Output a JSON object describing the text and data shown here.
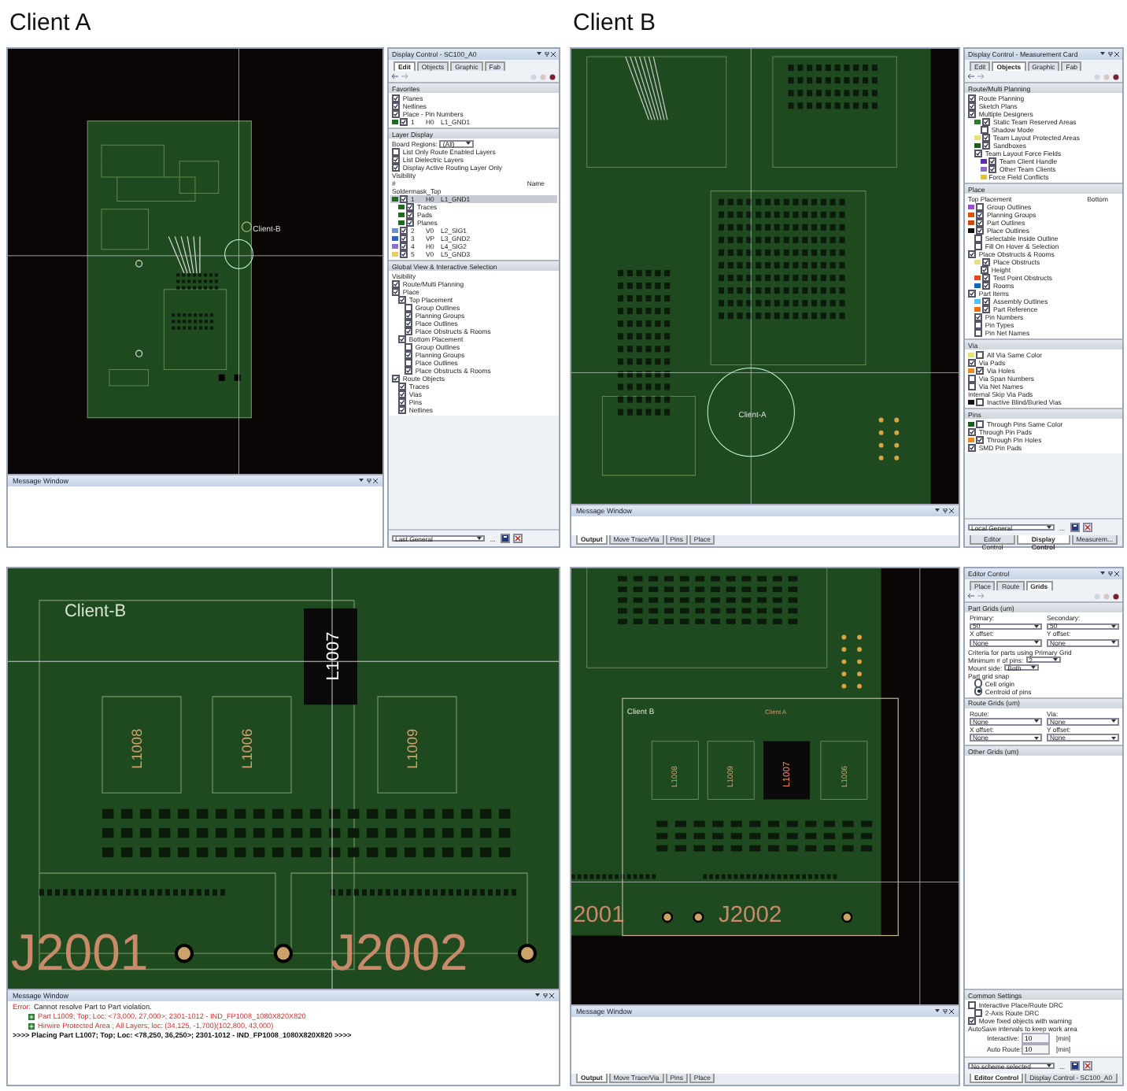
{
  "column_labels": [
    "Client A",
    "Client B"
  ],
  "quadrants": [
    {
      "canvas": {
        "kind": "overview-a",
        "labels": [
          "Client-B"
        ]
      },
      "message_window": {
        "title": "Message Window"
      },
      "panel": {
        "title": "Display Control - SC100_A0",
        "tabs": [
          {
            "label": "Edit",
            "selected": true
          },
          {
            "label": "Objects",
            "selected": false
          },
          {
            "label": "Graphic",
            "selected": false
          },
          {
            "label": "Fab",
            "selected": false
          }
        ],
        "sections": [
          {
            "title": "Favorites",
            "rows": [
              {
                "kind": "check",
                "label": "Planes",
                "checked": true
              },
              {
                "kind": "check",
                "label": "Netlines",
                "checked": true
              },
              {
                "kind": "check",
                "label": "Place - Pin Numbers",
                "checked": true
              },
              {
                "kind": "layer",
                "cells": [
                  "1",
                  "H0",
                  "L1_GND1"
                ],
                "checked": true,
                "color": "#1f6b1f",
                "selected": false
              }
            ]
          },
          {
            "title": "Layer Display",
            "rows": [
              {
                "kind": "field",
                "label": "Board Regions:",
                "value": "(All)"
              },
              {
                "kind": "check",
                "label": "List Only Route Enabled Layers",
                "checked": false
              },
              {
                "kind": "check",
                "label": "List Dielectric Layers",
                "checked": true
              },
              {
                "kind": "check",
                "label": "Display Active Routing Layer Only",
                "checked": true
              },
              {
                "kind": "text",
                "label": "Visibility"
              },
              {
                "kind": "header",
                "cells": [
                  "#",
                  "Name"
                ]
              },
              {
                "kind": "text",
                "label": "Soldermask_Top"
              },
              {
                "kind": "layer",
                "cells": [
                  "1",
                  "H0",
                  "L1_GND1"
                ],
                "checked": true,
                "color": "#1f6b1f",
                "selected": true,
                "children": [
                  {
                    "kind": "check",
                    "label": "Traces",
                    "checked": true,
                    "color": "#1f6b1f"
                  },
                  {
                    "kind": "check",
                    "label": "Pads",
                    "checked": true,
                    "color": "#1f6b1f"
                  },
                  {
                    "kind": "check",
                    "label": "Planes",
                    "checked": true,
                    "color": "#1f6b1f"
                  }
                ]
              },
              {
                "kind": "layer",
                "cells": [
                  "2",
                  "V0",
                  "L2_SIG1"
                ],
                "checked": true,
                "color": "#6d8fd6",
                "selected": false
              },
              {
                "kind": "layer",
                "cells": [
                  "3",
                  "VP",
                  "L3_GND2"
                ],
                "checked": true,
                "color": "#2f5fcf",
                "selected": false
              },
              {
                "kind": "layer",
                "cells": [
                  "4",
                  "H0",
                  "L4_SIG2"
                ],
                "checked": true,
                "color": "#8a6fd0",
                "selected": false
              },
              {
                "kind": "layer",
                "cells": [
                  "5",
                  "V0",
                  "L5_GND3"
                ],
                "checked": true,
                "color": "#e0d060",
                "selected": false
              }
            ]
          },
          {
            "title": "Global View & Interactive Selection",
            "rows": [
              {
                "kind": "text",
                "label": "Visibility"
              },
              {
                "kind": "check",
                "label": "Route/Multi Planning",
                "checked": true
              },
              {
                "kind": "check",
                "label": "Place",
                "checked": true,
                "children": [
                  {
                    "kind": "check",
                    "label": "Top Placement",
                    "checked": true,
                    "children": [
                      {
                        "kind": "check",
                        "label": "Group Outlines",
                        "checked": false
                      },
                      {
                        "kind": "check",
                        "label": "Planning Groups",
                        "checked": true
                      },
                      {
                        "kind": "check",
                        "label": "Place Outlines",
                        "checked": true
                      },
                      {
                        "kind": "check",
                        "label": "Place Obstructs & Rooms",
                        "checked": true
                      }
                    ]
                  },
                  {
                    "kind": "check",
                    "label": "Bottom Placement",
                    "checked": true,
                    "children": [
                      {
                        "kind": "check",
                        "label": "Group Outlines",
                        "checked": false
                      },
                      {
                        "kind": "check",
                        "label": "Planning Groups",
                        "checked": true
                      },
                      {
                        "kind": "check",
                        "label": "Place Outlines",
                        "checked": false
                      },
                      {
                        "kind": "check",
                        "label": "Place Obstructs & Rooms",
                        "checked": true
                      }
                    ]
                  }
                ]
              },
              {
                "kind": "check",
                "label": "Route Objects",
                "checked": true,
                "children": [
                  {
                    "kind": "check",
                    "label": "Traces",
                    "checked": true
                  },
                  {
                    "kind": "check",
                    "label": "Vias",
                    "checked": true
                  },
                  {
                    "kind": "check",
                    "label": "Pins",
                    "checked": true
                  },
                  {
                    "kind": "check",
                    "label": "Netlines",
                    "checked": true
                  }
                ]
              }
            ]
          }
        ],
        "footer": {
          "select": "Last General",
          "more": "..."
        }
      }
    },
    {
      "canvas": {
        "kind": "overview-b",
        "labels": [
          "Client-A"
        ]
      },
      "message_window": {
        "title": "Message Window",
        "tabs": [
          {
            "label": "Output",
            "selected": true
          },
          {
            "label": "Move Trace/Via",
            "selected": false
          },
          {
            "label": "Pins",
            "selected": false
          },
          {
            "label": "Place",
            "selected": false
          }
        ]
      },
      "panel": {
        "title": "Display Control - Measurement Card",
        "tabs": [
          {
            "label": "Edit",
            "selected": false
          },
          {
            "label": "Objects",
            "selected": true
          },
          {
            "label": "Graphic",
            "selected": false
          },
          {
            "label": "Fab",
            "selected": false
          }
        ],
        "sections": [
          {
            "title": "Route/Multi Planning",
            "rows": [
              {
                "kind": "check",
                "label": "Route Planning",
                "checked": true
              },
              {
                "kind": "check",
                "label": "Sketch Plans",
                "checked": true
              },
              {
                "kind": "check",
                "label": "Multiple Designers",
                "checked": true,
                "children": [
                  {
                    "kind": "check",
                    "label": "Static Team Reserved Areas",
                    "checked": true,
                    "color": "#2e7d32",
                    "children": [
                      {
                        "kind": "check",
                        "label": "Shadow Mode",
                        "checked": false
                      }
                    ]
                  },
                  {
                    "kind": "check",
                    "label": "Team Layout Protected Areas",
                    "checked": true,
                    "color": "#e8e07a"
                  },
                  {
                    "kind": "check",
                    "label": "Sandboxes",
                    "checked": true,
                    "color": "#1b5e20"
                  },
                  {
                    "kind": "check",
                    "label": "Team Layout Force Fields",
                    "checked": true,
                    "children": [
                      {
                        "kind": "check",
                        "label": "Team Client Handle",
                        "checked": true,
                        "color": "#5e2aa8"
                      },
                      {
                        "kind": "check",
                        "label": "Other Team Clients",
                        "checked": true,
                        "color": "#8d6ac8"
                      },
                      {
                        "kind": "text",
                        "label": "Force Field Conflicts",
                        "color": "#e0c040"
                      }
                    ]
                  }
                ]
              }
            ]
          },
          {
            "title": "Place",
            "rows": [
              {
                "kind": "header",
                "cells": [
                  "Top Placement",
                  "Bottom"
                ]
              },
              {
                "kind": "check",
                "label": "Group Outlines",
                "checked": false,
                "color": "#9c4dcc"
              },
              {
                "kind": "check",
                "label": "Planning Groups",
                "checked": true,
                "color": "#e65100"
              },
              {
                "kind": "check",
                "label": "Part Outlines",
                "checked": true,
                "color": "#d84315"
              },
              {
                "kind": "check",
                "label": "Place Outlines",
                "checked": true,
                "color": "#101010",
                "children": [
                  {
                    "kind": "check",
                    "label": "Selectable Inside Outline",
                    "checked": false
                  },
                  {
                    "kind": "check",
                    "label": "Fill On Hover & Selection",
                    "checked": false
                  }
                ]
              },
              {
                "kind": "check",
                "label": "Place Obstructs & Rooms",
                "checked": true,
                "children": [
                  {
                    "kind": "check",
                    "label": "Place Obstructs",
                    "checked": true,
                    "color": "#e8e07a",
                    "children": [
                      {
                        "kind": "check",
                        "label": "Height",
                        "checked": true
                      }
                    ]
                  },
                  {
                    "kind": "check",
                    "label": "Test Point Obstructs",
                    "checked": true,
                    "color": "#e64a19"
                  },
                  {
                    "kind": "check",
                    "label": "Rooms",
                    "checked": true,
                    "color": "#1565c0"
                  }
                ]
              },
              {
                "kind": "check",
                "label": "Part Items",
                "checked": true,
                "children": [
                  {
                    "kind": "check",
                    "label": "Assembly Outlines",
                    "checked": true,
                    "color": "#4fc3f7"
                  },
                  {
                    "kind": "check",
                    "label": "Part Reference",
                    "checked": true,
                    "color": "#ef6c00"
                  },
                  {
                    "kind": "check",
                    "label": "Pin Numbers",
                    "checked": true
                  },
                  {
                    "kind": "check",
                    "label": "Pin Types",
                    "checked": false
                  },
                  {
                    "kind": "check",
                    "label": "Pin Net Names",
                    "checked": false
                  }
                ]
              }
            ]
          },
          {
            "title": "Via",
            "rows": [
              {
                "kind": "check",
                "label": "All Via Same Color",
                "checked": false,
                "color": "#e8e07a"
              },
              {
                "kind": "check",
                "label": "Via Pads",
                "checked": true
              },
              {
                "kind": "check",
                "label": "Via Holes",
                "checked": true,
                "color": "#ef8a2a"
              },
              {
                "kind": "check",
                "label": "Via Span Numbers",
                "checked": false
              },
              {
                "kind": "check",
                "label": "Via Net Names",
                "checked": false
              },
              {
                "kind": "text",
                "label": "Internal Skip Via Pads"
              },
              {
                "kind": "check",
                "label": "Inactive Blind/Buried Vias",
                "checked": false,
                "color": "#101010"
              }
            ]
          },
          {
            "title": "Pins",
            "rows": [
              {
                "kind": "check",
                "label": "Through Pins Same Color",
                "checked": false,
                "color": "#1b5e20"
              },
              {
                "kind": "check",
                "label": "Through Pin Pads",
                "checked": true
              },
              {
                "kind": "check",
                "label": "Through Pin Holes",
                "checked": true,
                "color": "#ef8a2a"
              },
              {
                "kind": "check",
                "label": "SMD Pin Pads",
                "checked": true
              }
            ]
          }
        ],
        "footer": {
          "select": "Local General",
          "more": "..."
        },
        "bottom_tabs": [
          {
            "label": "Editor Control",
            "selected": false
          },
          {
            "label": "Display Control",
            "selected": true
          },
          {
            "label": "Measurem...",
            "selected": false
          }
        ]
      }
    },
    {
      "canvas": {
        "kind": "zoom-a",
        "labels": [
          "Client-B",
          "L1008",
          "L1006",
          "L1007",
          "L1009",
          "J2001",
          "J2002"
        ]
      },
      "message_window": {
        "title": "Message Window",
        "messages": [
          {
            "kind": "error",
            "label": "Error:",
            "text": "Cannot resolve Part to Part violation."
          },
          {
            "kind": "detail",
            "text": "Part L1009; Top; Loc: <73,000, 27,000>; 2301-1012 - IND_FP1008_1080X820X820"
          },
          {
            "kind": "detail",
            "text": "Hirwire Protected Area ; All Layers; loc: (34,125, -1,700)(102,800, 43,000)"
          },
          {
            "kind": "status",
            "text": ">>>> Placing Part L1007; Top; Loc: <78,250, 36,250>; 2301-1012 - IND_FP1008_1080X820X820 >>>>"
          }
        ]
      }
    },
    {
      "canvas": {
        "kind": "zoom-b",
        "labels": [
          "Client B",
          "Client A",
          "L1008",
          "L1009",
          "L1007",
          "L1006",
          "2001",
          "J2002"
        ]
      },
      "message_window": {
        "title": "Message Window",
        "tabs": [
          {
            "label": "Output",
            "selected": true
          },
          {
            "label": "Move Trace/Via",
            "selected": false
          },
          {
            "label": "Pins",
            "selected": false
          },
          {
            "label": "Place",
            "selected": false
          }
        ]
      },
      "panel": {
        "title": "Editor Control",
        "tabs": [
          {
            "label": "Place",
            "selected": false
          },
          {
            "label": "Route",
            "selected": false
          },
          {
            "label": "Grids",
            "selected": true
          }
        ],
        "sections": [
          {
            "title": "Part Grids (um)",
            "rows": [
              {
                "kind": "fields",
                "items": [
                  {
                    "label": "Primary:",
                    "value": "50"
                  },
                  {
                    "label": "Secondary:",
                    "value": "50"
                  },
                  {
                    "label": "X offset:",
                    "value": "None"
                  },
                  {
                    "label": "Y offset:",
                    "value": "None"
                  }
                ]
              },
              {
                "kind": "text",
                "label": "Criteria for parts using Primary Grid"
              },
              {
                "kind": "field",
                "label": "Minimum # of pins:",
                "value": "2"
              },
              {
                "kind": "field",
                "label": "Mount side:",
                "value": "Both"
              },
              {
                "kind": "text",
                "label": "Part grid snap"
              },
              {
                "kind": "radio",
                "label": "Cell origin",
                "selected": false
              },
              {
                "kind": "radio",
                "label": "Centroid of pins",
                "selected": true
              }
            ]
          },
          {
            "title": "Route Grids (um)",
            "rows": [
              {
                "kind": "fields",
                "items": [
                  {
                    "label": "Route:",
                    "value": "None"
                  },
                  {
                    "label": "Via:",
                    "value": "None"
                  },
                  {
                    "label": "X offset:",
                    "value": "None"
                  },
                  {
                    "label": "Y offset:",
                    "value": "None"
                  }
                ]
              }
            ]
          },
          {
            "title": "Other Grids (um)"
          },
          {
            "title": "Common Settings",
            "rows": [
              {
                "kind": "check",
                "label": "Interactive Place/Route DRC",
                "checked": false,
                "children": [
                  {
                    "kind": "check",
                    "label": "2-Axis Route DRC",
                    "checked": false
                  }
                ]
              },
              {
                "kind": "check",
                "label": "Move fixed objects with warning",
                "checked": true
              },
              {
                "kind": "text",
                "label": "AutoSave intervals to keep work area"
              },
              {
                "kind": "input",
                "label": "Interactive:",
                "value": "10",
                "unit": "[min]"
              },
              {
                "kind": "input",
                "label": "Auto Route:",
                "value": "10",
                "unit": "[min]"
              }
            ]
          }
        ],
        "footer": {
          "select": "No scheme selected",
          "more": "..."
        },
        "bottom_tabs": [
          {
            "label": "Editor Control",
            "selected": true
          },
          {
            "label": "Display Control - SC100_A0",
            "selected": false
          }
        ]
      }
    }
  ]
}
